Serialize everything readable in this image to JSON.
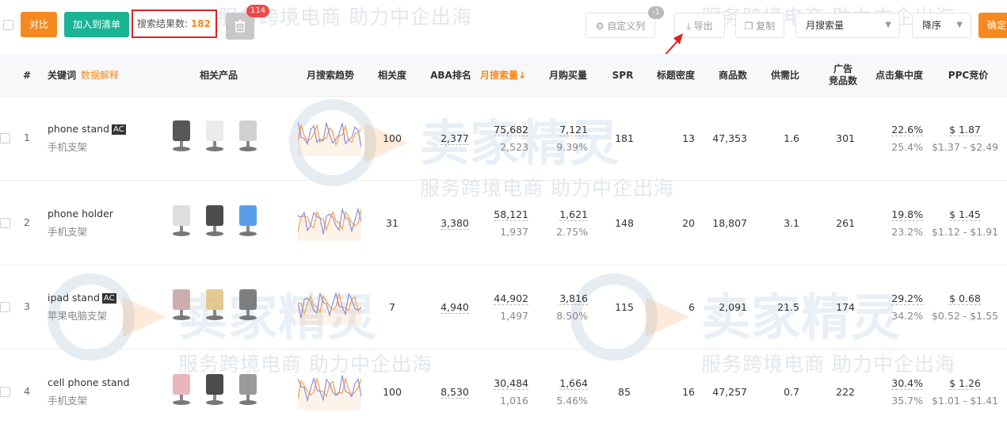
{
  "toolbar": {
    "compare_label": "对比",
    "add_to_list_label": "加入到清单",
    "result_label": "搜索结果数:",
    "result_count": "182",
    "trash_badge": "114",
    "custom_columns_label": "自定义列",
    "custom_columns_badge": "-1",
    "export_label": "导出",
    "copy_label": "复制",
    "sort_field_value": "月搜索量",
    "sort_order_value": "降序",
    "confirm_label": "确定"
  },
  "watermark": {
    "brand": "卖家精灵",
    "tagline": "服务跨境电商  助力中企出海"
  },
  "table": {
    "headers": {
      "index": "#",
      "keyword": "关键词",
      "keyword_link": "数据解释",
      "products": "相关产品",
      "trend": "月搜索趋势",
      "relevance": "相关度",
      "aba_rank": "ABA排名",
      "monthly_search": "月搜索量↓",
      "monthly_purchase": "月购买量",
      "spr": "SPR",
      "title_density": "标题密度",
      "product_count": "商品数",
      "supply_demand": "供需比",
      "ad_products_l1": "广告",
      "ad_products_l2": "竞品数",
      "click_concentration": "点击集中度",
      "ppc": "PPC竞价"
    },
    "rows": [
      {
        "index": "1",
        "keyword": "phone stand",
        "ac": "AC",
        "translation": "手机支架",
        "relevance": "100",
        "aba_rank": "2,377",
        "search": "75,682",
        "search_sub": "2,523",
        "purchase": "7,121",
        "purchase_rate": "9.39%",
        "spr": "181",
        "title_density": "13",
        "products": "47,353",
        "supply_demand": "1.6",
        "ad_products": "301",
        "click1": "22.6%",
        "click2": "25.4%",
        "ppc": "$ 1.87",
        "ppc_range": "$1.37 - $2.49"
      },
      {
        "index": "2",
        "keyword": "phone holder",
        "ac": "",
        "translation": "手机支架",
        "relevance": "31",
        "aba_rank": "3,380",
        "search": "58,121",
        "search_sub": "1,937",
        "purchase": "1,621",
        "purchase_rate": "2.75%",
        "spr": "148",
        "title_density": "20",
        "products": "18,807",
        "supply_demand": "3.1",
        "ad_products": "261",
        "click1": "19.8%",
        "click2": "23.2%",
        "ppc": "$ 1.45",
        "ppc_range": "$1.12 - $1.91"
      },
      {
        "index": "3",
        "keyword": "ipad stand",
        "ac": "AC",
        "translation": "苹果电脑支架",
        "relevance": "7",
        "aba_rank": "4,940",
        "search": "44,902",
        "search_sub": "1,497",
        "purchase": "3,816",
        "purchase_rate": "8.50%",
        "spr": "115",
        "title_density": "6",
        "products": "2,091",
        "supply_demand": "21.5",
        "ad_products": "174",
        "click1": "29.2%",
        "click2": "34.2%",
        "ppc": "$ 0.68",
        "ppc_range": "$0.52 - $1.55"
      },
      {
        "index": "4",
        "keyword": "cell phone stand",
        "ac": "",
        "translation": "手机支架",
        "relevance": "100",
        "aba_rank": "8,530",
        "search": "30,484",
        "search_sub": "1,016",
        "purchase": "1,664",
        "purchase_rate": "5.46%",
        "spr": "85",
        "title_density": "16",
        "products": "47,257",
        "supply_demand": "0.7",
        "ad_products": "222",
        "click1": "30.4%",
        "click2": "35.7%",
        "ppc": "$ 1.26",
        "ppc_range": "$1.01 - $1.41"
      }
    ]
  },
  "colors": {
    "orange": "#f5891f",
    "teal": "#1ab394",
    "red_highlight": "#e02020",
    "trend_orange": "#f5a04a",
    "trend_purple": "#8b8ee0"
  }
}
